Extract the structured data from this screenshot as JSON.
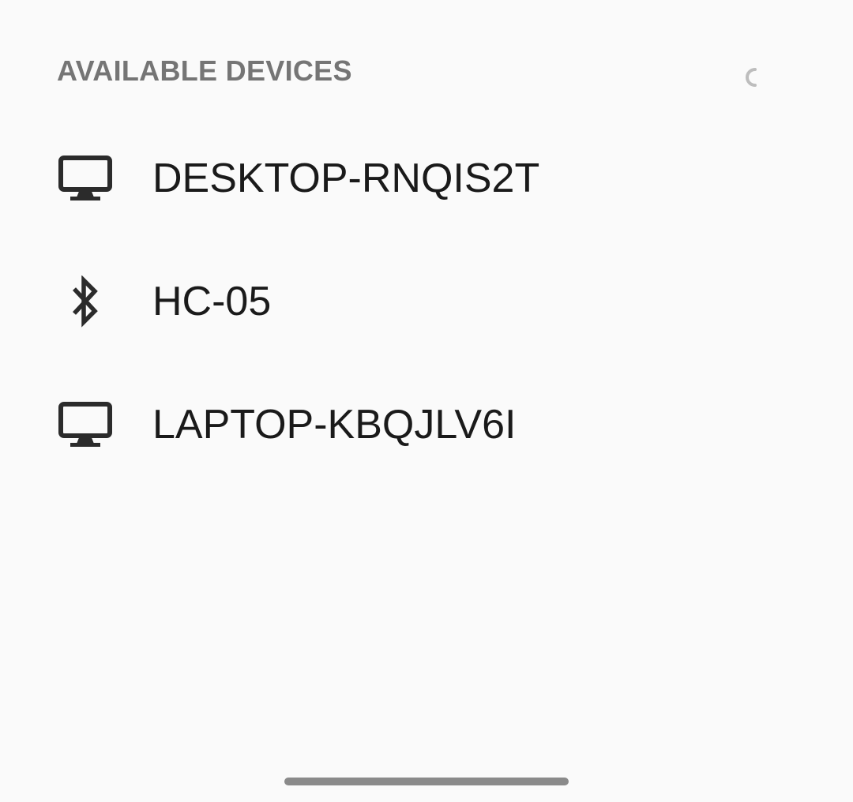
{
  "header": {
    "title": "AVAILABLE DEVICES"
  },
  "devices": [
    {
      "name": "DESKTOP-RNQIS2T",
      "icon": "computer-icon"
    },
    {
      "name": "HC-05",
      "icon": "bluetooth-icon"
    },
    {
      "name": "LAPTOP-KBQJLV6I",
      "icon": "computer-icon"
    }
  ],
  "colors": {
    "background": "#fafafa",
    "header_text": "#757575",
    "item_text": "#1a1a1a",
    "icon": "#2b2b2b",
    "nav_handle": "#8a8a8a"
  }
}
